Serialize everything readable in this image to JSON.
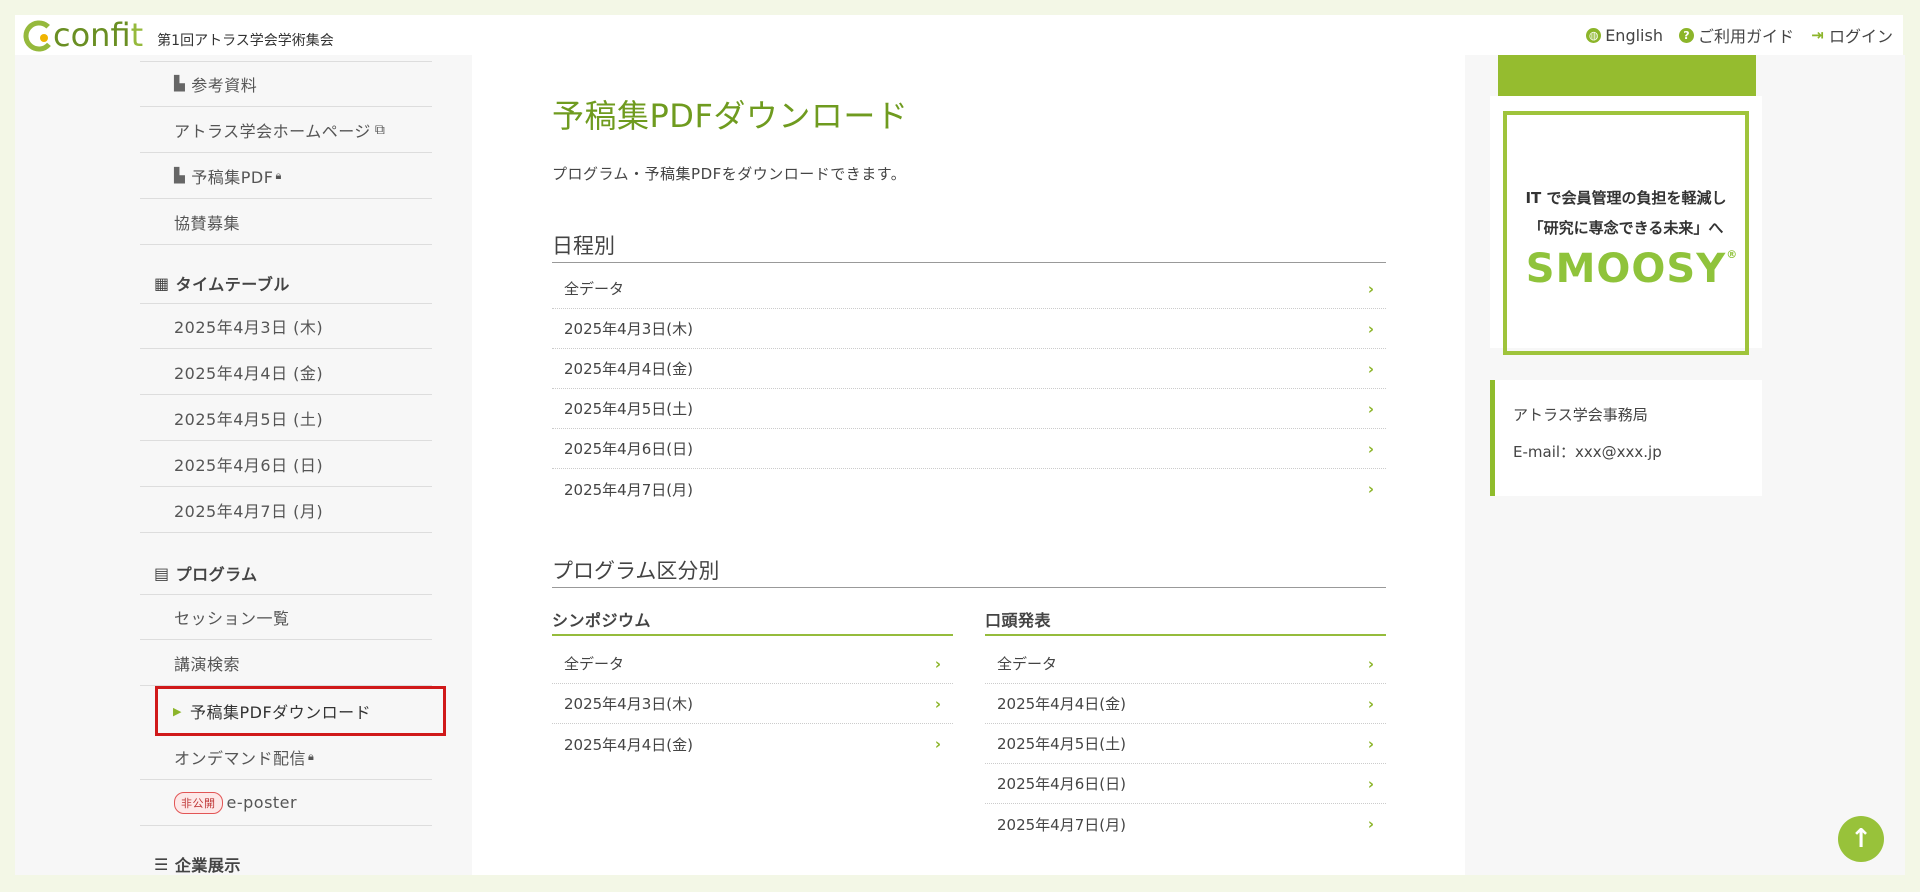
{
  "header": {
    "logo_c": "C",
    "logo_conf": "conf",
    "logo_it": "it",
    "event_title": "第1回アトラス学会学術集会",
    "links": {
      "english": "English",
      "guide": "ご利用ガイド",
      "login": "ログイン"
    }
  },
  "sidebar": {
    "items_top": [
      {
        "label": "参考資料"
      },
      {
        "label": "アトラス学会ホームページ"
      },
      {
        "label": "予稿集PDF"
      },
      {
        "label": "協賛募集"
      }
    ],
    "timetable_heading": "タイムテーブル",
    "timetable_items": [
      "2025年4月3日 (木)",
      "2025年4月4日 (金)",
      "2025年4月5日 (土)",
      "2025年4月6日 (日)",
      "2025年4月7日 (月)"
    ],
    "program_heading": "プログラム",
    "program_items": {
      "session_list": "セッション一覧",
      "lecture_search": "講演検索",
      "pdf_download": "予稿集PDFダウンロード",
      "on_demand": "オンデマンド配信",
      "eposter_badge": "非公開",
      "eposter": "e-poster"
    },
    "exhibit_heading": "企業展示"
  },
  "main": {
    "title": "予稿集PDFダウンロード",
    "description": "プログラム・予稿集PDFをダウンロードできます。",
    "by_date": {
      "heading": "日程別",
      "rows": [
        "全データ",
        "2025年4月3日(木)",
        "2025年4月4日(金)",
        "2025年4月5日(土)",
        "2025年4月6日(日)",
        "2025年4月7日(月)"
      ]
    },
    "by_category": {
      "heading": "プログラム区分別",
      "symposium": {
        "heading": "シンポジウム",
        "rows": [
          "全データ",
          "2025年4月3日(木)",
          "2025年4月4日(金)"
        ]
      },
      "oral": {
        "heading": "口頭発表",
        "rows": [
          "全データ",
          "2025年4月4日(金)",
          "2025年4月5日(土)",
          "2025年4月6日(日)",
          "2025年4月7日(月)"
        ]
      }
    }
  },
  "right": {
    "ad": {
      "line1": "IT で会員管理の負担を軽減し",
      "line2": "「研究に専念できる未来」へ",
      "brand": "SMOOSY",
      "reg": "®"
    },
    "contact": {
      "org": "アトラス学会事務局",
      "email": "E-mail：xxx@xxx.jp"
    }
  },
  "colors": {
    "accent": "#8cb52a",
    "title_green": "#6f9b1f",
    "highlight_red": "#d0191a",
    "background": "#f3f7e6"
  }
}
